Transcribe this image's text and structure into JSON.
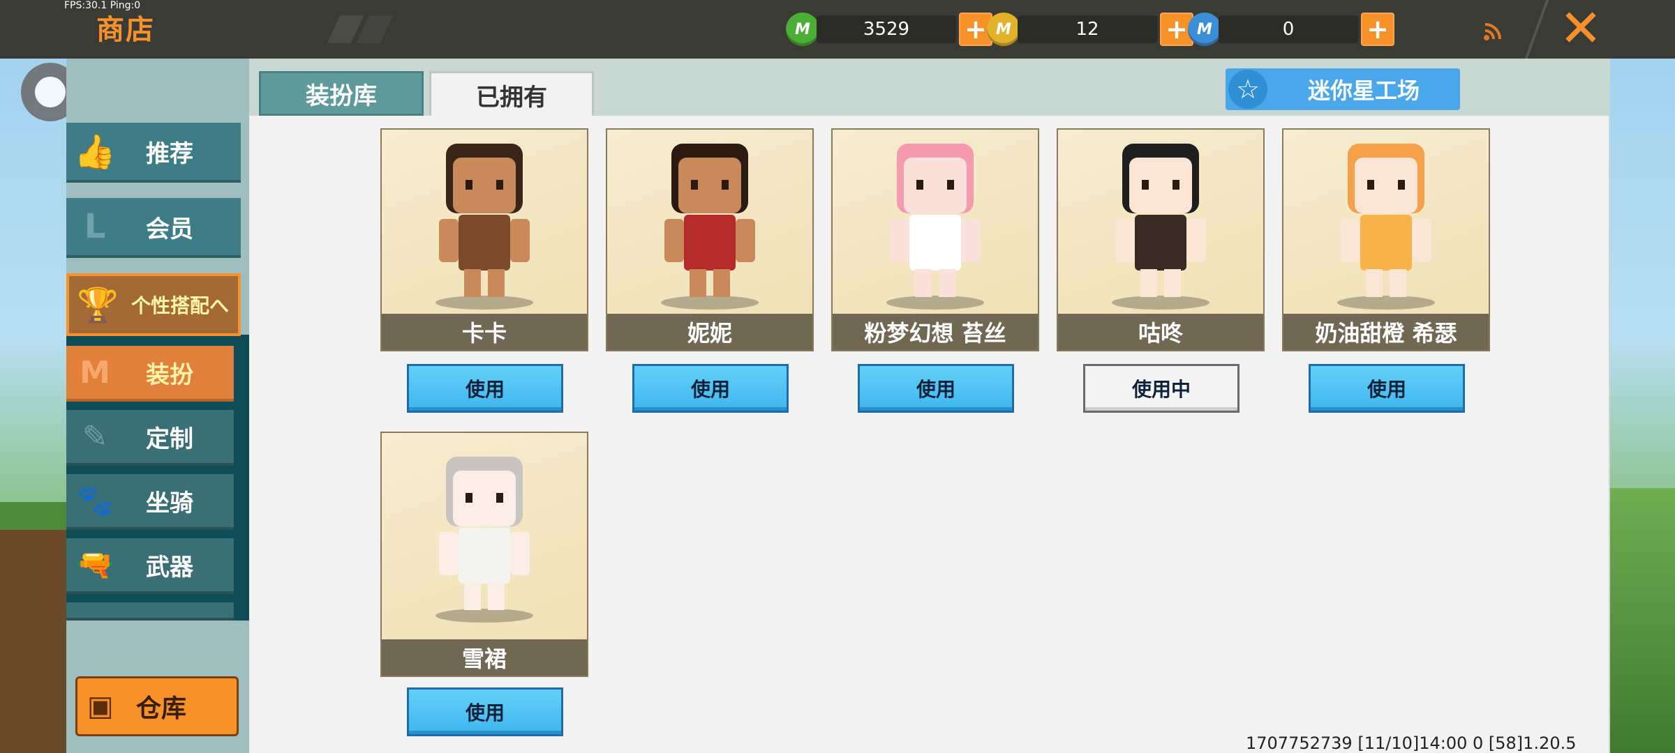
{
  "debug": {
    "fps_text": "FPS:30.1  Ping:0"
  },
  "header": {
    "title": "商店"
  },
  "currencies": [
    {
      "icon": "green-gem-icon",
      "symbol": "M",
      "value": "3529",
      "color": "#4caf35"
    },
    {
      "icon": "gold-coin-icon",
      "symbol": "M",
      "value": "12",
      "color": "#e3b12a"
    },
    {
      "icon": "blue-coin-icon",
      "symbol": "M",
      "value": "0",
      "color": "#3c8fd6"
    }
  ],
  "sidebar": {
    "items": [
      {
        "label": "推荐",
        "icon": "thumbs-up-icon"
      },
      {
        "label": "会员",
        "icon": "vip-icon"
      },
      {
        "label": "个性搭配へ",
        "icon": "trophy-icon"
      }
    ],
    "sub_items": [
      {
        "label": "装扮",
        "icon": "m-shirt-icon"
      },
      {
        "label": "定制",
        "icon": "pencil-icon"
      },
      {
        "label": "坐骑",
        "icon": "mount-icon"
      },
      {
        "label": "武器",
        "icon": "revolver-icon"
      }
    ],
    "warehouse_label": "仓库"
  },
  "tabs": {
    "library": "装扮库",
    "owned": "已拥有"
  },
  "workshop_label": "迷你星工场",
  "skins": [
    {
      "name": "卡卡",
      "button": "使用",
      "in_use": false,
      "skin": "#c88a5a",
      "hair": "#3a2418",
      "outfit": "#7a4a2a"
    },
    {
      "name": "妮妮",
      "button": "使用",
      "in_use": false,
      "skin": "#c88a5a",
      "hair": "#2a1a12",
      "outfit": "#b52a2a"
    },
    {
      "name": "粉梦幻想 苔丝",
      "button": "使用",
      "in_use": false,
      "skin": "#fbe1dc",
      "hair": "#f69ab0",
      "outfit": "#ffffff"
    },
    {
      "name": "咕咚",
      "button": "使用中",
      "in_use": true,
      "skin": "#fbe6d6",
      "hair": "#1e1e1e",
      "outfit": "#3a2a24"
    },
    {
      "name": "奶油甜橙 希瑟",
      "button": "使用",
      "in_use": false,
      "skin": "#fbe6d6",
      "hair": "#f5a04a",
      "outfit": "#f8b24a"
    },
    {
      "name": "雪裙",
      "button": "使用",
      "in_use": false,
      "skin": "#fbeee6",
      "hair": "#c9c4c0",
      "outfit": "#f4f4f0"
    }
  ],
  "footer": {
    "info": "1707752739   [11/10]14:00 0    [58]1.20.5"
  }
}
